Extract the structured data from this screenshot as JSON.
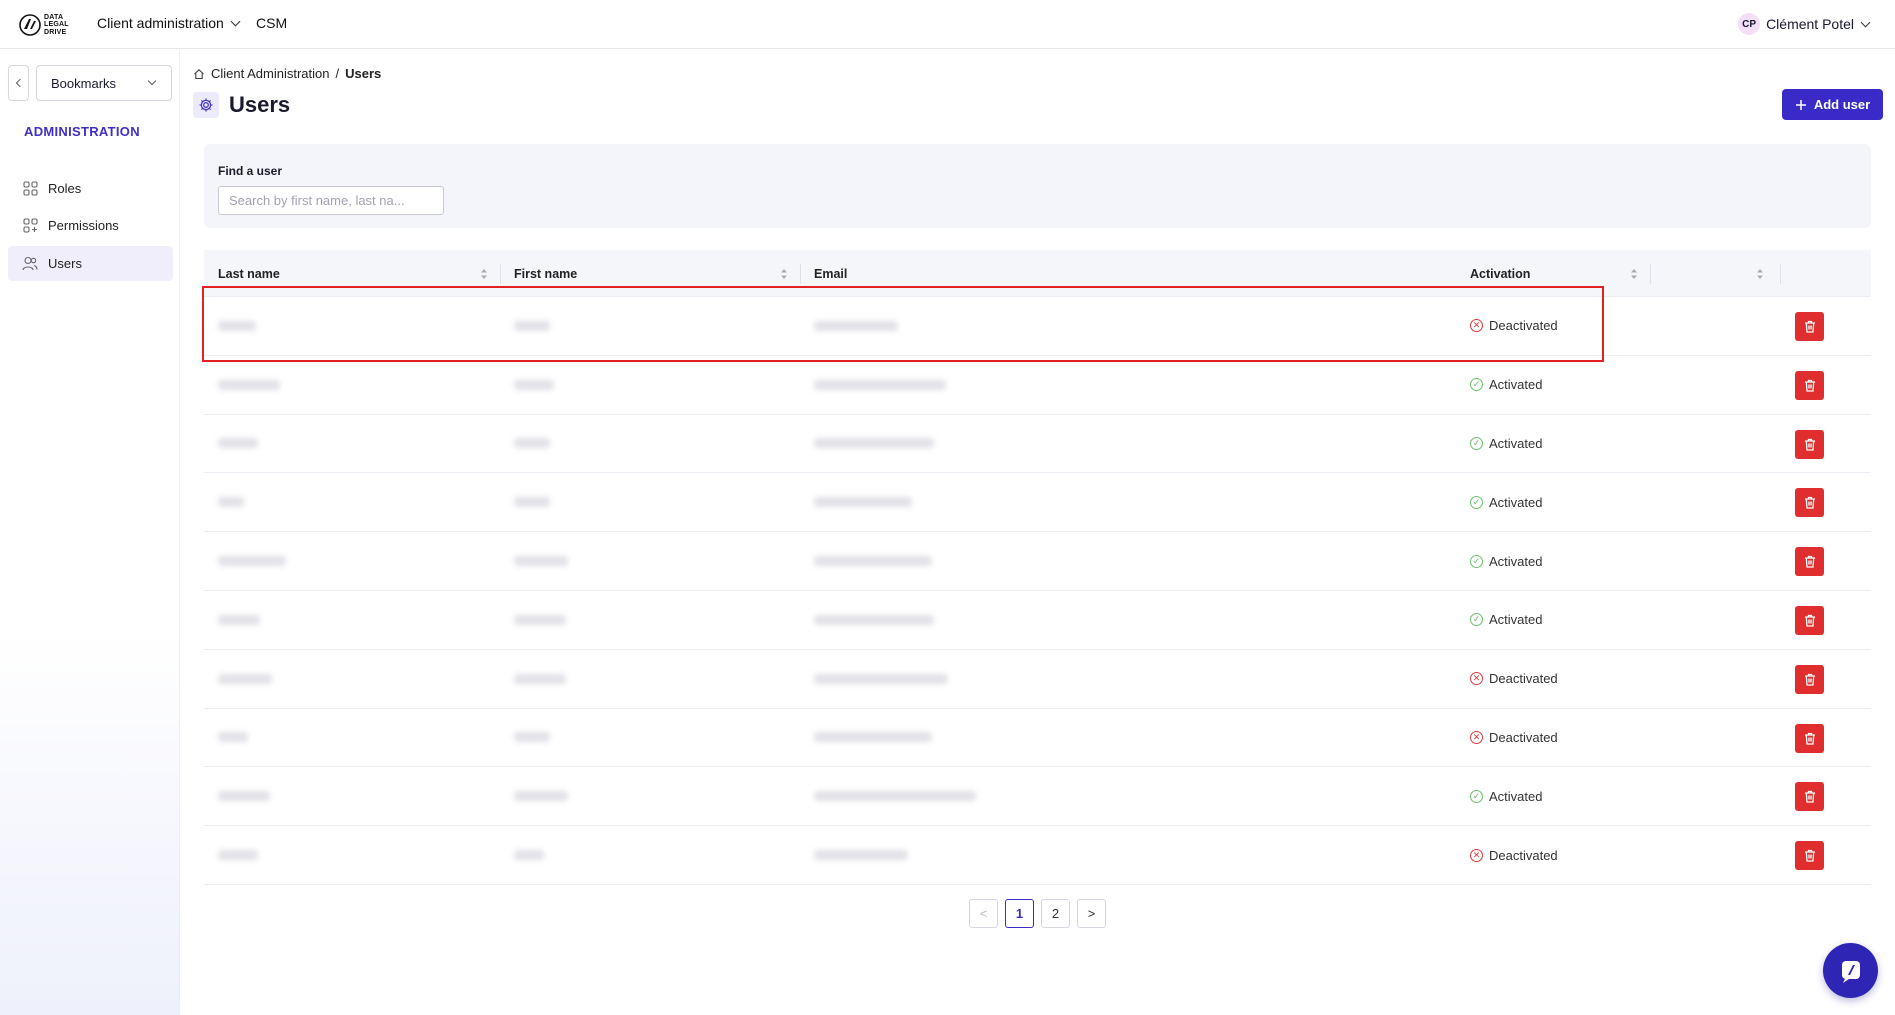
{
  "header": {
    "logo_lines": [
      "DATA",
      "LEGAL",
      "DRIVE"
    ],
    "nav": [
      {
        "label": "Client administration",
        "has_dropdown": true
      },
      {
        "label": "CSM",
        "has_dropdown": false
      }
    ],
    "user": {
      "initials": "CP",
      "name": "Clément Potel"
    }
  },
  "sidebar": {
    "bookmarks_label": "Bookmarks",
    "section_title": "ADMINISTRATION",
    "items": [
      {
        "label": "Roles",
        "icon": "grid-icon",
        "active": false
      },
      {
        "label": "Permissions",
        "icon": "grid-plus-icon",
        "active": false
      },
      {
        "label": "Users",
        "icon": "users-icon",
        "active": true
      }
    ]
  },
  "breadcrumb": {
    "root": "Client Administration",
    "separator": "/",
    "current": "Users"
  },
  "page": {
    "title": "Users",
    "add_button": "Add user"
  },
  "search": {
    "label": "Find a user",
    "placeholder": "Search by first name, last na...",
    "value": ""
  },
  "table": {
    "columns": [
      "Last name",
      "First name",
      "Email",
      "Activation"
    ],
    "rows": [
      {
        "status": "Deactivated",
        "active": false
      },
      {
        "status": "Activated",
        "active": true
      },
      {
        "status": "Activated",
        "active": true
      },
      {
        "status": "Activated",
        "active": true
      },
      {
        "status": "Activated",
        "active": true
      },
      {
        "status": "Activated",
        "active": true
      },
      {
        "status": "Deactivated",
        "active": false
      },
      {
        "status": "Deactivated",
        "active": false
      },
      {
        "status": "Activated",
        "active": true
      },
      {
        "status": "Deactivated",
        "active": false
      }
    ]
  },
  "pagination": {
    "prev": "<",
    "pages": [
      "1",
      "2"
    ],
    "current": "1",
    "next": ">"
  },
  "colors": {
    "accent": "#3a2bc8",
    "danger": "#e02d2d",
    "success": "#6cc06c"
  }
}
